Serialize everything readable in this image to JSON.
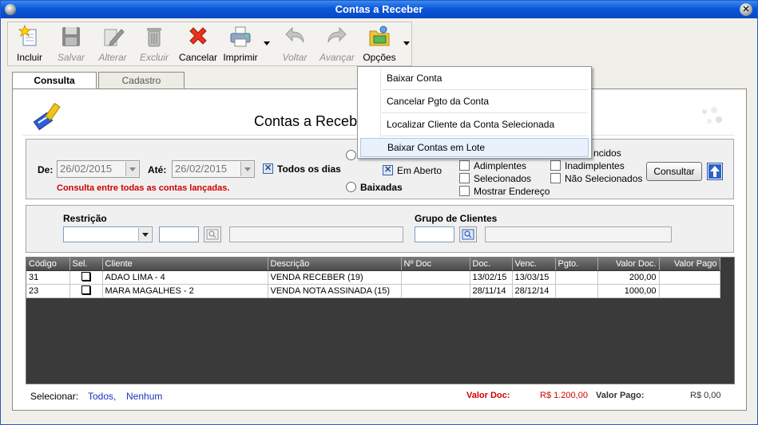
{
  "window": {
    "title": "Contas a Receber"
  },
  "toolbar": {
    "incluir": "Incluir",
    "salvar": "Salvar",
    "alterar": "Alterar",
    "excluir": "Excluir",
    "cancelar": "Cancelar",
    "imprimir": "Imprimir",
    "voltar": "Voltar",
    "avancar": "Avançar",
    "opcoes": "Opções"
  },
  "tabs": [
    {
      "label": "Consulta"
    },
    {
      "label": "Cadastro"
    }
  ],
  "header": {
    "title": "Contas a Receber"
  },
  "filters": {
    "de_label": "De:",
    "de_value": "26/02/2015",
    "ate_label": "Até:",
    "ate_value": "26/02/2015",
    "todos_dias": "Todos os dias",
    "em_aberto": "Em Aberto",
    "baixadas": "Baixadas",
    "vencidos_partial": "ncidos",
    "adimplentes": "Adimplentes",
    "inadimplentes": "Inadimplentes",
    "selecionados": "Selecionados",
    "nao_selecionados": "Não Selecionados",
    "mostrar_endereco": "Mostrar Endereço",
    "message": "Consulta entre todas as contas lançadas.",
    "consultar": "Consultar"
  },
  "restricao": {
    "label": "Restrição",
    "grupo_label": "Grupo de Clientes"
  },
  "table": {
    "columns": [
      "Código",
      "Sel.",
      "Cliente",
      "Descrição",
      "Nº Doc",
      "Doc.",
      "Venc.",
      "Pgto.",
      "Valor Doc.",
      "Valor Pago"
    ],
    "rows": [
      {
        "codigo": "31",
        "cliente": "ADAO LIMA - 4",
        "descricao": "VENDA RECEBER (19)",
        "ndoc": "",
        "doc": "13/02/15",
        "venc": "13/03/15",
        "pgto": "",
        "valor_doc": "200,00",
        "valor_pago": ""
      },
      {
        "codigo": "23",
        "cliente": "MARA MAGALHES - 2",
        "descricao": "VENDA NOTA ASSINADA (15)",
        "ndoc": "",
        "doc": "28/11/14",
        "venc": "28/12/14",
        "pgto": "",
        "valor_doc": "1000,00",
        "valor_pago": ""
      }
    ]
  },
  "footer": {
    "selecionar": "Selecionar:",
    "todos": "Todos,",
    "nenhum": "Nenhum",
    "valor_doc_label": "Valor Doc:",
    "valor_doc": "R$ 1.200,00",
    "valor_pago_label": "Valor Pago:",
    "valor_pago": "R$ 0,00"
  },
  "menu": {
    "items": [
      {
        "label": "Baixar Conta"
      },
      {
        "label": "Cancelar Pgto da Conta"
      },
      {
        "label": "Localizar Cliente da Conta Selecionada"
      },
      {
        "label": "Baixar Contas em Lote"
      }
    ]
  },
  "colors": {
    "title_bar": "#0a56d8",
    "error_text": "#d00000",
    "link": "#1d2fbf",
    "grid_header": "#4a4a4a",
    "menu_highlight": "#e8f1fc"
  }
}
